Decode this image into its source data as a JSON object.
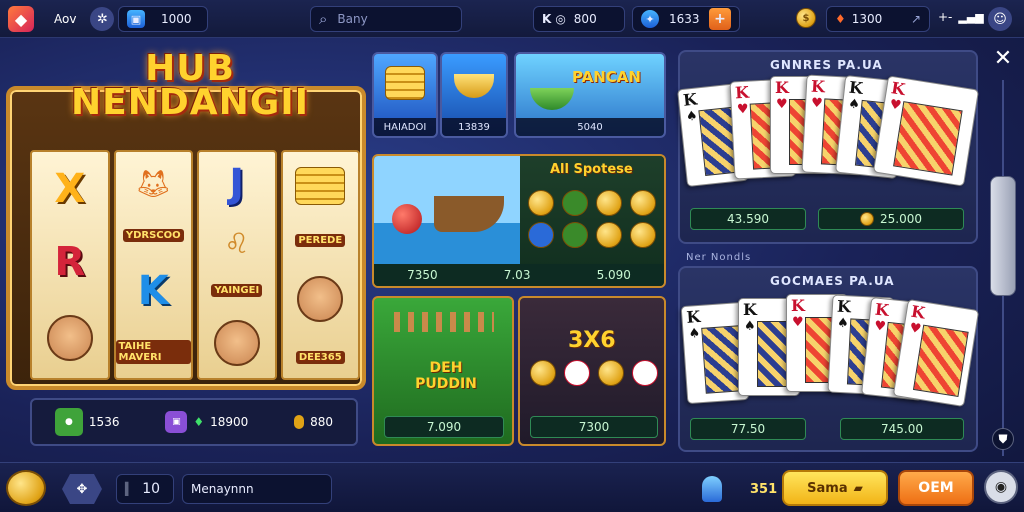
{
  "topbar": {
    "profile_label": "Aov",
    "balance_1": "1000",
    "search_placeholder": "Bany",
    "counter": "800",
    "gems": "1633",
    "coins": "1300",
    "signal_label": "+-"
  },
  "slot": {
    "title_line1": "HUB",
    "title_line2": "NENDANGII",
    "reel_labels": [
      "YDRSCOO",
      "TAIHE MAVERI",
      "YAINGEI",
      "PEREDE",
      "DEE365"
    ],
    "bottom": {
      "stat1": "1536",
      "stat2": "18900",
      "stat3": "880"
    }
  },
  "games": {
    "tile_a_caption": "HAIADOI",
    "tile_b_caption": "13839",
    "tile_c_title": "PANCAN",
    "tile_c_caption": "5040",
    "tile_d_caption": "7350",
    "tile_e_title": "All Spotese",
    "tile_e_values": [
      "7.03",
      "5.090"
    ],
    "tile_f_title": "DEH PUDDIN",
    "tile_f_value": "7.090",
    "tile_g_title": "3X6",
    "tile_g_value": "7300"
  },
  "cards_top": {
    "title": "GNNRES PA.UA",
    "value_left": "43.590",
    "value_right": "25.000"
  },
  "cards_bottom": {
    "subtitle": "Ner Nondls",
    "title": "GOCMAES PA.UA",
    "value_left": "77.50",
    "value_right": "745.00"
  },
  "bottombar": {
    "count": "10",
    "input_value": "Menaynnn",
    "counter": "351",
    "btn_yellow": "Sama",
    "btn_orange": "OEM"
  },
  "colors": {
    "accent": "#f2b417",
    "primary_bg": "#1a2258",
    "action": "#ee6f14"
  }
}
